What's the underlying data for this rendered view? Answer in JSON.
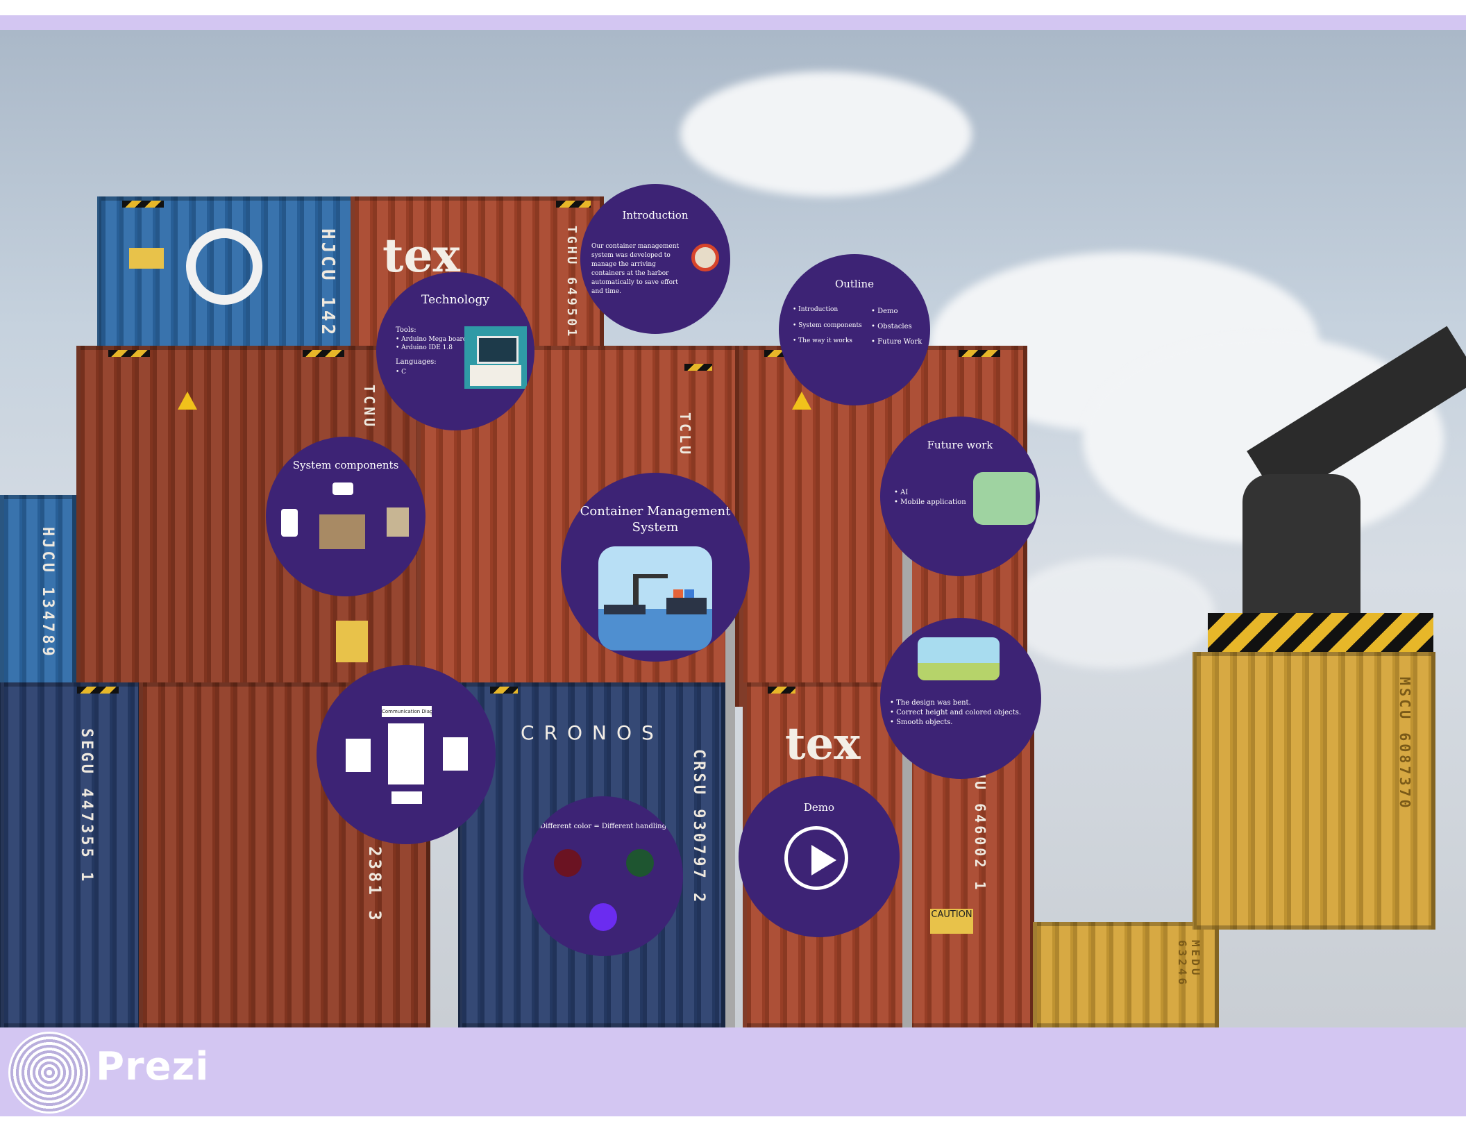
{
  "branding": {
    "name": "Prezi"
  },
  "colors": {
    "bubble": "#3d2375",
    "band": "#d3c6f2"
  },
  "background": {
    "container_markings": [
      "tex",
      "HJCU 142",
      "TGHU 649501",
      "TCNU",
      "TCLU",
      "HJCU 134789",
      "SEGU 447355 1",
      "2381 3",
      "CRONOS",
      "CRSU 930797 2",
      "tex",
      "HU 646002 1",
      "CAUTION",
      "MSCU 6087370",
      "MEDU 63246"
    ]
  },
  "bubbles": {
    "introduction": {
      "title": "Introduction",
      "body": "Our container management system was developed to manage the arriving containers at the harbor automatically to save effort and time."
    },
    "technology": {
      "title": "Technology",
      "tools_label": "Tools:",
      "tools": [
        "Arduino Mega board",
        "Arduino IDE 1.8"
      ],
      "languages_label": "Languages:",
      "languages": [
        "C"
      ]
    },
    "outline": {
      "title": "Outline",
      "left": [
        "Introduction",
        "System components",
        "The way it works"
      ],
      "right": [
        "Demo",
        "Obstacles",
        "Future Work"
      ]
    },
    "system_components": {
      "title": "System components"
    },
    "main": {
      "title": "Container Management System"
    },
    "future_work": {
      "title": "Future work",
      "items": [
        "AI",
        "Mobile application"
      ]
    },
    "obstacles": {
      "items": [
        "The design was bent.",
        "Correct height and colored objects.",
        "Smooth objects."
      ]
    },
    "diagram": {
      "title": "Communication Diagram"
    },
    "colors_handling": {
      "title": "Different color = Different handling"
    },
    "demo": {
      "title": "Demo"
    }
  }
}
